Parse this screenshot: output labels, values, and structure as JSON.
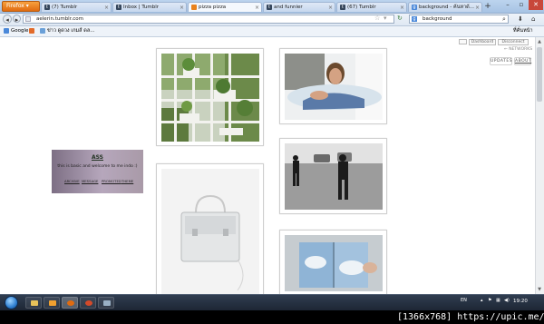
{
  "browser": {
    "firefox_button": "Firefox",
    "tabs": [
      {
        "label": "(7) Tumblr",
        "favicon": "tumblr-t"
      },
      {
        "label": "Inbox | Tumblr",
        "favicon": "tumblr-t"
      },
      {
        "label": "pizza pizza",
        "favicon": "pizza-slice",
        "active": true
      },
      {
        "label": "and funnier",
        "favicon": "tumblr-t"
      },
      {
        "label": "(67) Tumblr",
        "favicon": "tumblr-t"
      },
      {
        "label": "background - ค้นหาด้...",
        "favicon": "google-g"
      }
    ],
    "new_tab": "+",
    "url": "aelerin.tumblr.com",
    "search_value": "background",
    "search_engine_icon": "google-g"
  },
  "bookmarks": {
    "items": [
      {
        "label": "Google",
        "favicon": "google-g"
      },
      {
        "label": "ข่าว ดูดวง เกมส์ ดล...",
        "favicon": "news-page"
      }
    ],
    "right_label": "ที่คั่นหน้า"
  },
  "tumblr": {
    "top_controls": [
      "Dashboard",
      "Disconnect"
    ],
    "network_label": "← NETWORKS",
    "updates_label": "UPDATES",
    "about_label": "ABOUT",
    "profile": {
      "title": "ASS",
      "description": "this is basic and welcome to me indo :)",
      "links": [
        "ARCHIVE",
        "MESSAGE",
        "PROMOTED",
        "THEME"
      ]
    },
    "posts": [
      {
        "alt": "Garden shelves with plants",
        "kind": "plants"
      },
      {
        "alt": "Man lying on bed",
        "kind": "portrait"
      },
      {
        "alt": "Clear plastic handbag",
        "kind": "bag"
      },
      {
        "alt": "Two people walking outdoors",
        "kind": "walking"
      },
      {
        "alt": "Hands holding open book with sky print",
        "kind": "book"
      }
    ]
  },
  "taskbar": {
    "tray_language": "EN",
    "clock": "19:20"
  },
  "watermark": "[1366x768] https://upic.me/",
  "colors": {
    "tab_bg": "#c6d7ee",
    "firefox_orange": "#e06b10",
    "taskbar": "#1c2533",
    "card_purple": "#9d8fa3"
  }
}
